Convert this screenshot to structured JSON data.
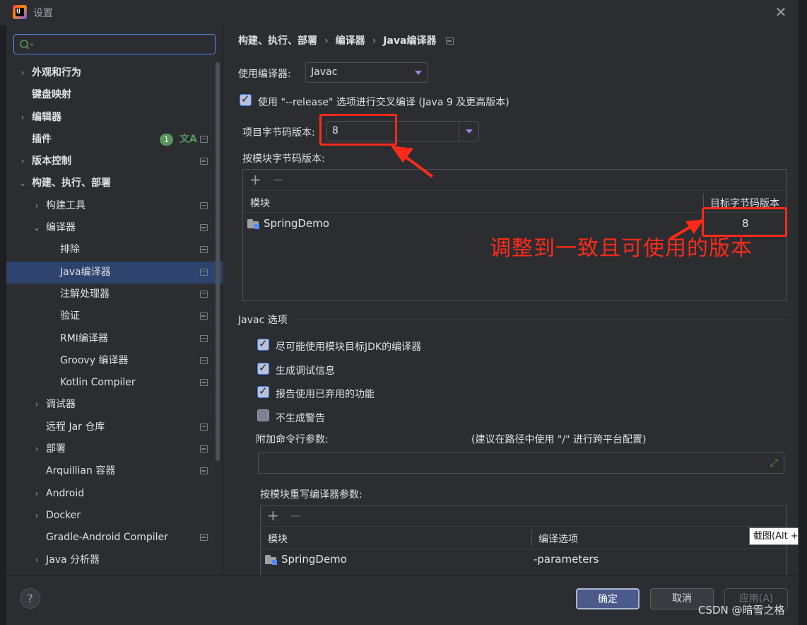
{
  "window": {
    "title": "设置"
  },
  "search": {
    "placeholder": ""
  },
  "sidebar": {
    "items": [
      {
        "label": "外观和行为",
        "arrow": "›",
        "bold": true
      },
      {
        "label": "键盘映射",
        "arrow": "",
        "bold": true
      },
      {
        "label": "编辑器",
        "arrow": "›",
        "bold": true
      },
      {
        "label": "插件",
        "arrow": "",
        "bold": true,
        "badge": "1",
        "translate_icon": "文A"
      },
      {
        "label": "版本控制",
        "arrow": "›",
        "bold": true
      },
      {
        "label": "构建、执行、部署",
        "arrow": "⌄",
        "bold": true
      },
      {
        "label": "构建工具",
        "arrow": "›"
      },
      {
        "label": "编译器",
        "arrow": "⌄"
      },
      {
        "label": "排除",
        "arrow": ""
      },
      {
        "label": "Java编译器",
        "arrow": "",
        "selected": true
      },
      {
        "label": "注解处理器",
        "arrow": ""
      },
      {
        "label": "验证",
        "arrow": ""
      },
      {
        "label": "RMI编译器",
        "arrow": ""
      },
      {
        "label": "Groovy 编译器",
        "arrow": ""
      },
      {
        "label": "Kotlin Compiler",
        "arrow": ""
      },
      {
        "label": "调试器",
        "arrow": "›"
      },
      {
        "label": "远程 Jar 仓库",
        "arrow": ""
      },
      {
        "label": "部署",
        "arrow": "›"
      },
      {
        "label": "Arquillian 容器",
        "arrow": ""
      },
      {
        "label": "Android",
        "arrow": "›"
      },
      {
        "label": "Docker",
        "arrow": "›"
      },
      {
        "label": "Gradle-Android Compiler",
        "arrow": ""
      },
      {
        "label": "Java 分析器",
        "arrow": "›"
      }
    ]
  },
  "breadcrumb": {
    "part1": "构建、执行、部署",
    "sep": "›",
    "part2": "编译器",
    "part3": "Java编译器"
  },
  "main": {
    "compiler_label": "使用编译器:",
    "compiler_value": "Javac",
    "release_checkbox_label": "使用 \"--release\" 选项进行交叉编译 (Java 9 及更高版本)",
    "bytecode_label": "项目字节码版本:",
    "bytecode_value": "8",
    "per_module_label": "按模块字节码版本:",
    "module_table": {
      "col_module": "模块",
      "col_target": "目标字节码版本",
      "rows": [
        {
          "module": "SpringDemo",
          "target": "8"
        }
      ]
    },
    "javac_section": "Javac 选项",
    "options": [
      {
        "label": "尽可能使用模块目标JDK的编译器",
        "checked": true
      },
      {
        "label": "生成调试信息",
        "checked": true
      },
      {
        "label": "报告使用已弃用的功能",
        "checked": true
      },
      {
        "label": "不生成警告",
        "checked": false
      }
    ],
    "cmd_params_label": "附加命令行参数:",
    "cmd_params_hint": "(建议在路径中使用 \"/\" 进行跨平台配置)",
    "cmd_params_value": "",
    "override_label": "按模块重写编译器参数:",
    "override_table": {
      "col_module": "模块",
      "col_options": "编译选项",
      "rows": [
        {
          "module": "SpringDemo",
          "options": "-parameters"
        }
      ]
    }
  },
  "footer": {
    "help": "?",
    "ok": "确定",
    "cancel": "取消",
    "apply": "应用(A)",
    "watermark": "CSDN @暗雪之格"
  },
  "annotation": {
    "text": "调整到一致且可使用的版本",
    "color": "#ff2a1a"
  },
  "tooltip": {
    "text": "截图(Alt + A)"
  },
  "colors": {
    "accent": "#3574f0",
    "selected_row": "#2e436e",
    "badge": "#57965c"
  }
}
